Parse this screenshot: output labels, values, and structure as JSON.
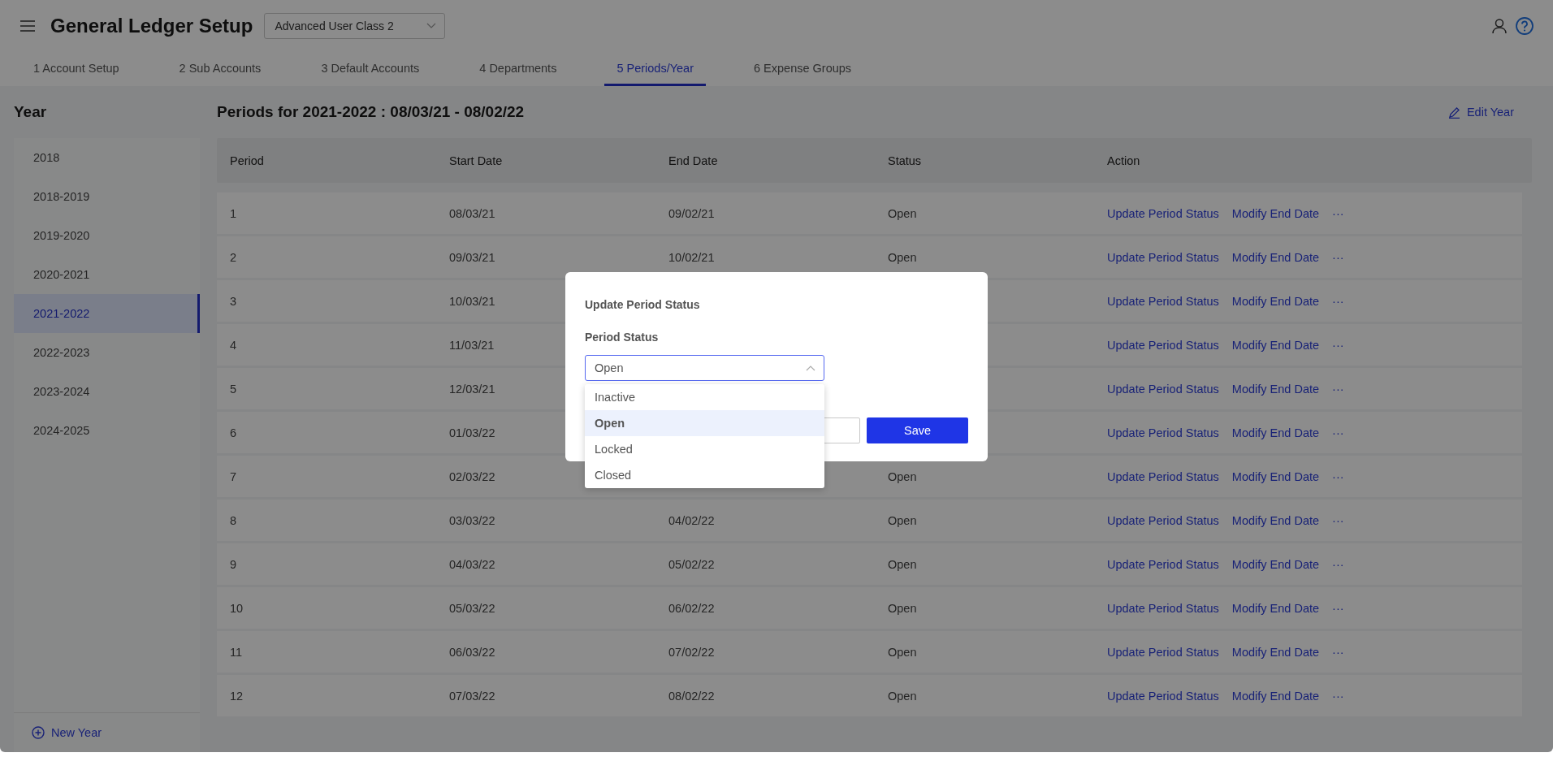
{
  "header": {
    "title": "General Ledger Setup",
    "class_select": {
      "value": "Advanced User Class 2"
    }
  },
  "tabs": [
    {
      "label": "1 Account Setup",
      "selected": false
    },
    {
      "label": "2 Sub Accounts",
      "selected": false
    },
    {
      "label": "3 Default Accounts",
      "selected": false
    },
    {
      "label": "4 Departments",
      "selected": false
    },
    {
      "label": "5 Periods/Year",
      "selected": true
    },
    {
      "label": "6 Expense Groups",
      "selected": false
    }
  ],
  "sidebar": {
    "title": "Year",
    "items": [
      {
        "label": "2018",
        "selected": false
      },
      {
        "label": "2018-2019",
        "selected": false
      },
      {
        "label": "2019-2020",
        "selected": false
      },
      {
        "label": "2020-2021",
        "selected": false
      },
      {
        "label": "2021-2022",
        "selected": true
      },
      {
        "label": "2022-2023",
        "selected": false
      },
      {
        "label": "2023-2024",
        "selected": false
      },
      {
        "label": "2024-2025",
        "selected": false
      }
    ],
    "new_button": "New Year"
  },
  "main": {
    "title": "Periods for 2021-2022 : 08/03/21 - 08/02/22",
    "edit_button": "Edit Year"
  },
  "table": {
    "columns": [
      "Period",
      "Start Date",
      "End Date",
      "Status",
      "Action"
    ],
    "rows": [
      {
        "period": "1",
        "start_date": "08/03/21",
        "end_date": "09/02/21",
        "status": "Open",
        "actions": [
          "Update Period Status",
          "Modify End Date",
          "···"
        ]
      },
      {
        "period": "2",
        "start_date": "09/03/21",
        "end_date": "10/02/21",
        "status": "Open",
        "actions": [
          "Update Period Status",
          "Modify End Date",
          "···"
        ]
      },
      {
        "period": "3",
        "start_date": "10/03/21",
        "actions": [
          "Update Period Status",
          "Modify End Date",
          "···"
        ]
      },
      {
        "period": "4",
        "start_date": "11/03/21",
        "actions": [
          "Update Period Status",
          "Modify End Date",
          "···"
        ]
      },
      {
        "period": "5",
        "start_date": "12/03/21",
        "actions": [
          "Update Period Status",
          "Modify End Date",
          "···"
        ]
      },
      {
        "period": "6",
        "start_date": "01/03/22",
        "actions": [
          "Update Period Status",
          "Modify End Date",
          "···"
        ]
      },
      {
        "period": "7",
        "start_date": "02/03/22",
        "status": "Open",
        "actions": [
          "Update Period Status",
          "Modify End Date",
          "···"
        ]
      },
      {
        "period": "8",
        "start_date": "03/03/22",
        "end_date": "04/02/22",
        "status": "Open",
        "actions": [
          "Update Period Status",
          "Modify End Date",
          "···"
        ]
      },
      {
        "period": "9",
        "start_date": "04/03/22",
        "end_date": "05/02/22",
        "status": "Open",
        "actions": [
          "Update Period Status",
          "Modify End Date",
          "···"
        ]
      },
      {
        "period": "10",
        "start_date": "05/03/22",
        "end_date": "06/02/22",
        "status": "Open",
        "actions": [
          "Update Period Status",
          "Modify End Date",
          "···"
        ]
      },
      {
        "period": "11",
        "start_date": "06/03/22",
        "end_date": "07/02/22",
        "status": "Open",
        "actions": [
          "Update Period Status",
          "Modify End Date",
          "···"
        ]
      },
      {
        "period": "12",
        "start_date": "07/03/22",
        "end_date": "08/02/22",
        "status": "Open",
        "actions": [
          "Update Period Status",
          "Modify End Date",
          "···"
        ]
      }
    ]
  },
  "modal": {
    "title": "Update Period Status",
    "field_label": "Period Status",
    "select": {
      "value": "Open",
      "expanded": true,
      "options": [
        {
          "label": "Inactive",
          "selected": false
        },
        {
          "label": "Open",
          "selected": true
        },
        {
          "label": "Locked",
          "selected": false
        },
        {
          "label": "Closed",
          "selected": false
        }
      ]
    },
    "buttons": [
      {
        "kind": "secondary"
      },
      {
        "kind": "primary",
        "label": "Save"
      }
    ]
  }
}
